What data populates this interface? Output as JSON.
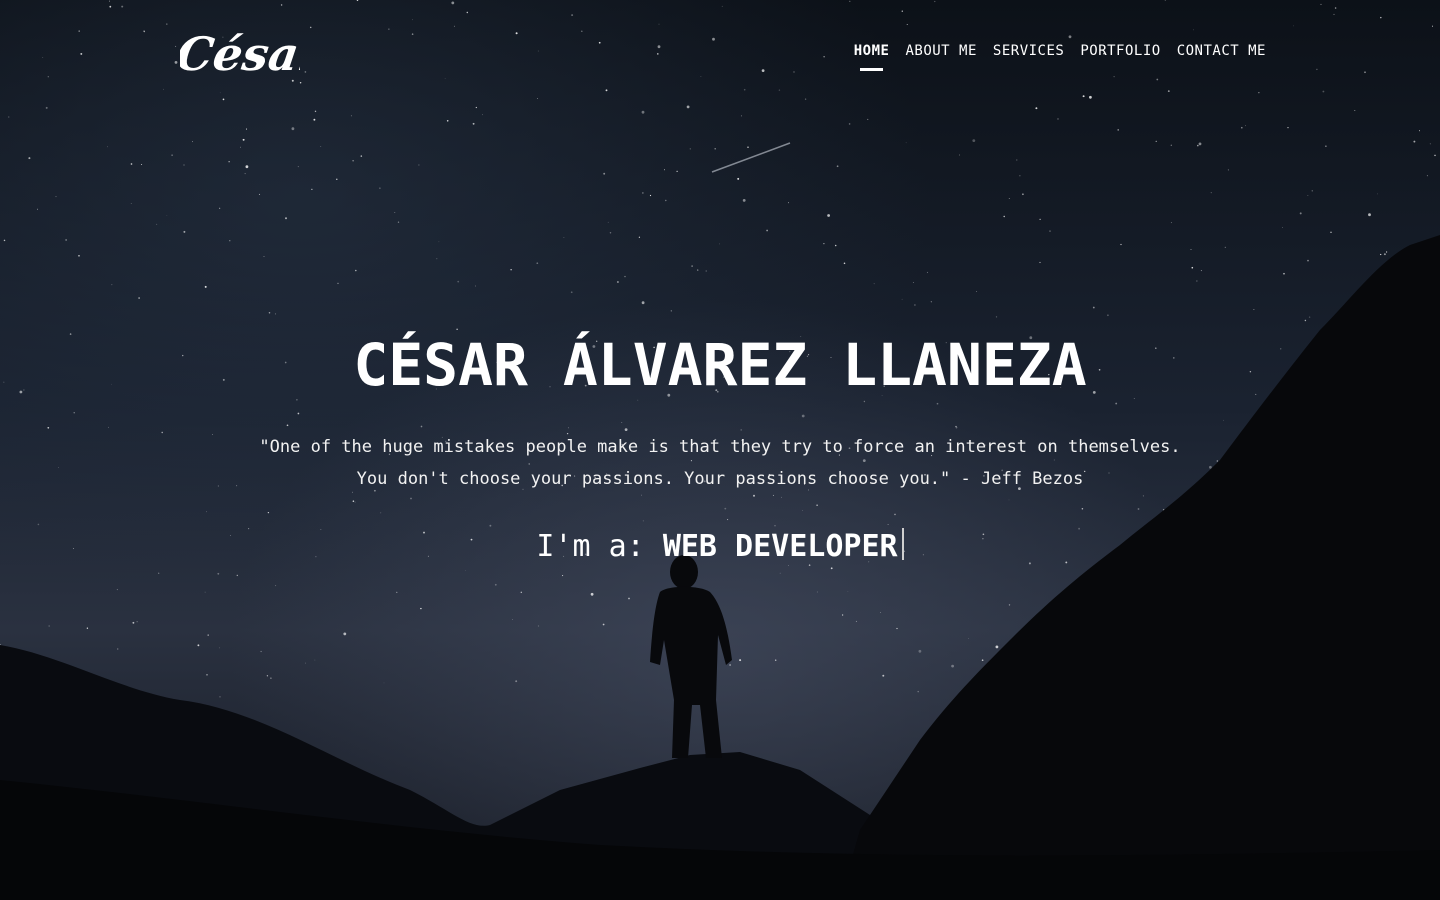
{
  "brand": {
    "logo_text": "César."
  },
  "nav": {
    "items": [
      {
        "label": "HOME",
        "active": true
      },
      {
        "label": "ABOUT ME",
        "active": false
      },
      {
        "label": "SERVICES",
        "active": false
      },
      {
        "label": "PORTFOLIO",
        "active": false
      },
      {
        "label": "CONTACT ME",
        "active": false
      }
    ]
  },
  "hero": {
    "name": "CÉSAR ÁLVAREZ LLANEZA",
    "quote_line1": "\"One of the huge mistakes people make is that they try to force an interest on themselves.",
    "quote_line2": "You don't choose your passions. Your passions choose you.\" - Jeff Bezos",
    "role_prefix": "I'm a:",
    "role_value": "WEB DEVELOPER"
  },
  "colors": {
    "text": "#ffffff",
    "sky_top": "#0c1118",
    "sky_mid": "#2a3140",
    "silhouette": "#06070a"
  }
}
